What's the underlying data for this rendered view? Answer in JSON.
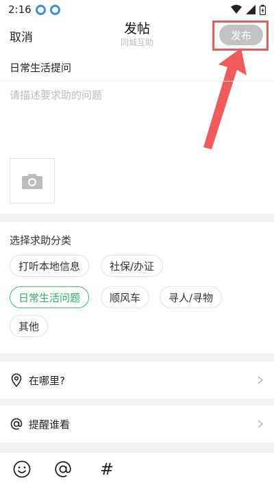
{
  "status": {
    "time": "2:16"
  },
  "header": {
    "cancel_label": "取消",
    "title": "发帖",
    "subtitle": "同城互助",
    "publish_label": "发布"
  },
  "topic": "日常生活提问",
  "composer": {
    "placeholder": "请描述要求助的问题"
  },
  "category": {
    "title": "选择求助分类",
    "items": [
      {
        "label": "打听本地信息",
        "selected": false
      },
      {
        "label": "社保/办证",
        "selected": false
      },
      {
        "label": "日常生活问题",
        "selected": true
      },
      {
        "label": "顺风车",
        "selected": false
      },
      {
        "label": "寻人/寻物",
        "selected": false
      },
      {
        "label": "其他",
        "selected": false
      }
    ]
  },
  "rows": {
    "location_label": "在哪里?",
    "mention_label": "提醒谁看"
  },
  "toolbar": {
    "hash_symbol": "#"
  },
  "colors": {
    "accent_green": "#2db35f",
    "publish_disabled": "#c2c2c2",
    "annotation_red": "#f05a5a"
  }
}
